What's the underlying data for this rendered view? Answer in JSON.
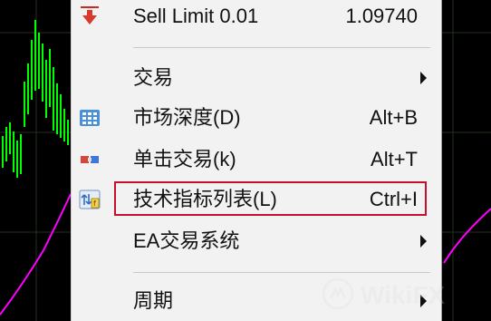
{
  "menu": {
    "items": [
      {
        "label": "Sell Limit 0.01",
        "shortcut": "1.09740",
        "icon": "sell-limit-arrow-icon"
      },
      {
        "label": "交易",
        "shortcut": "",
        "icon": ""
      },
      {
        "label": "市场深度(D)",
        "shortcut": "Alt+B",
        "icon": "market-depth-icon"
      },
      {
        "label": "单击交易(k)",
        "shortcut": "Alt+T",
        "icon": "one-click-trading-icon"
      },
      {
        "label": "技术指标列表(L)",
        "shortcut": "Ctrl+I",
        "icon": "indicators-list-icon"
      },
      {
        "label": "EA交易系统",
        "shortcut": "",
        "icon": ""
      },
      {
        "label": "周期",
        "shortcut": "",
        "icon": ""
      }
    ]
  },
  "colors": {
    "chart_background": "#000000",
    "menu_background": "#f2f2f2",
    "highlight_border": "#c8102e",
    "candle_green": "#00ff00",
    "moving_average": "#ff00ff"
  }
}
